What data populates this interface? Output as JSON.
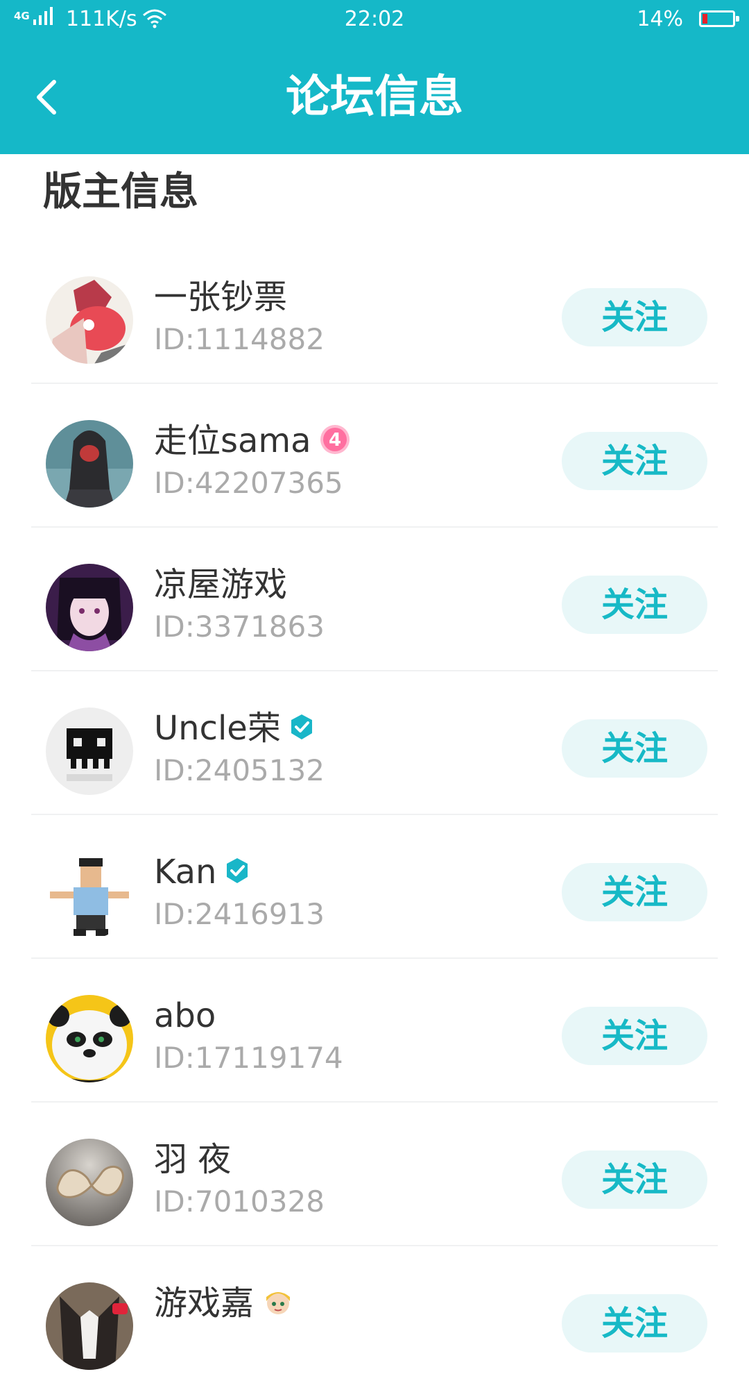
{
  "status_bar": {
    "network": "4G",
    "speed": "111K/s",
    "time": "22:02",
    "battery": "14%"
  },
  "header": {
    "title": "论坛信息"
  },
  "section_title": "版主信息",
  "colors": {
    "primary": "#15b8c8",
    "follow_bg": "#e8f7f8",
    "follow_text": "#17b9c6",
    "level_badge": "#ff6fa0"
  },
  "moderators": [
    {
      "name": "一张钞票",
      "id": "ID:1114882",
      "follow": "关注",
      "badge": ""
    },
    {
      "name": "走位sama",
      "id": "ID:42207365",
      "follow": "关注",
      "badge": "level-badge",
      "badge_text": "4"
    },
    {
      "name": "凉屋游戏",
      "id": "ID:3371863",
      "follow": "关注",
      "badge": ""
    },
    {
      "name": "Uncle荣",
      "id": "ID:2405132",
      "follow": "关注",
      "badge": "verified-icon"
    },
    {
      "name": "Kan",
      "id": "ID:2416913",
      "follow": "关注",
      "badge": "verified-icon"
    },
    {
      "name": "abo",
      "id": "ID:17119174",
      "follow": "关注",
      "badge": ""
    },
    {
      "name": "羽 夜",
      "id": "ID:7010328",
      "follow": "关注",
      "badge": ""
    },
    {
      "name": "游戏嘉",
      "id": "",
      "follow": "关注",
      "badge": "emoji-badge-icon"
    }
  ]
}
